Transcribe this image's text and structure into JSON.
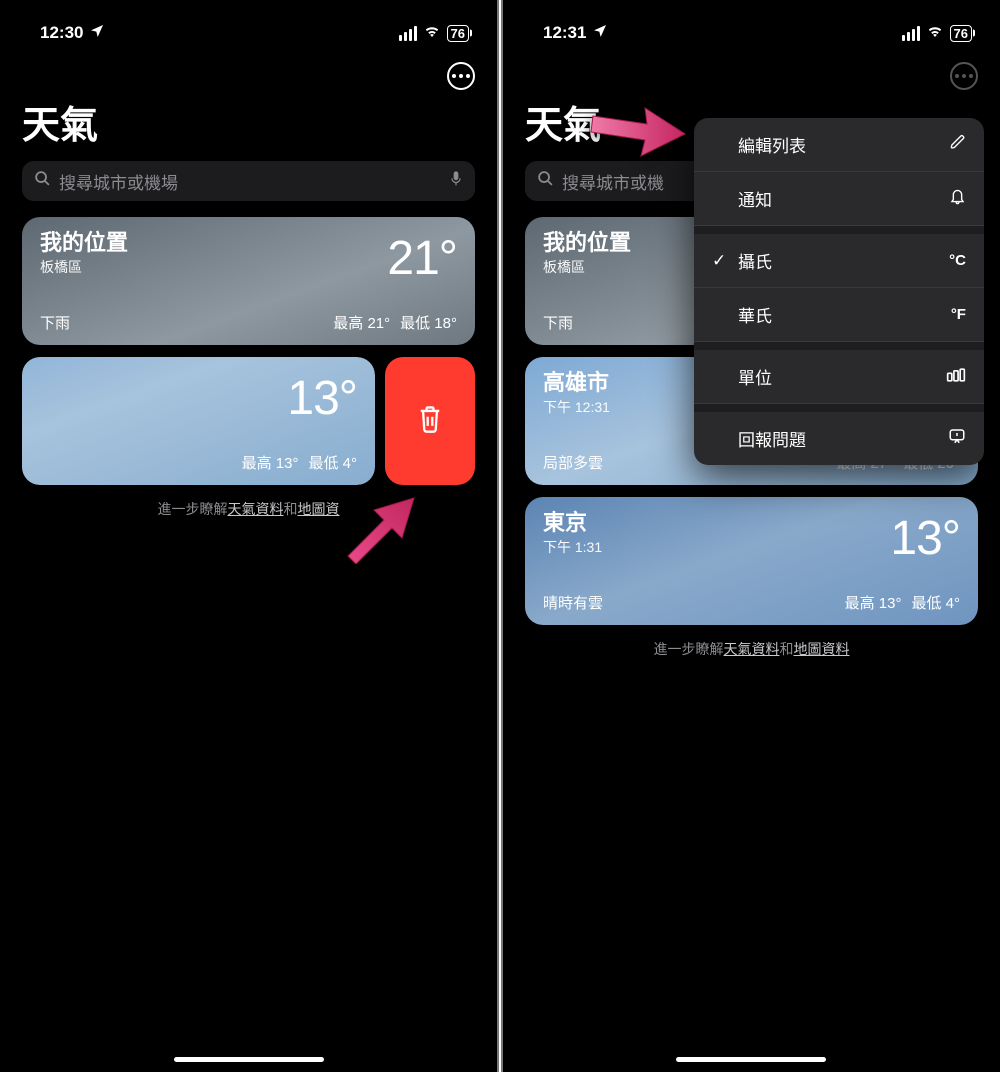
{
  "left": {
    "status": {
      "time": "12:30",
      "battery": "76"
    },
    "app_title": "天氣",
    "search_placeholder": "搜尋城市或機場",
    "cards": [
      {
        "title": "我的位置",
        "subtitle": "板橋區",
        "temp": "21°",
        "cond": "下雨",
        "hi": "最高 21°",
        "lo": "最低 18°"
      },
      {
        "title": "",
        "subtitle": "",
        "temp": "13°",
        "cond": "",
        "hi": "最高 13°",
        "lo": "最低 4°"
      }
    ],
    "footer_pre": "進一步瞭解",
    "footer_link1": "天氣資料",
    "footer_mid": "和",
    "footer_link2": "地圖資"
  },
  "right": {
    "status": {
      "time": "12:31",
      "battery": "76"
    },
    "app_title": "天氣",
    "search_placeholder": "搜尋城市或機",
    "menu": {
      "edit": "編輯列表",
      "notify": "通知",
      "celsius": "攝氏",
      "celsius_sym": "°C",
      "fahrenheit": "華氏",
      "fahrenheit_sym": "°F",
      "units": "單位",
      "report": "回報問題"
    },
    "cards": [
      {
        "title": "我的位置",
        "subtitle": "板橋區",
        "temp": "",
        "cond": "下雨",
        "hi": "",
        "lo": ""
      },
      {
        "title": "高雄市",
        "subtitle": "下午 12:31",
        "temp": "",
        "cond": "局部多雲",
        "hi": "最高 27°",
        "lo": "最低 20°"
      },
      {
        "title": "東京",
        "subtitle": "下午 1:31",
        "temp": "13°",
        "cond": "晴時有雲",
        "hi": "最高 13°",
        "lo": "最低 4°"
      }
    ],
    "footer_pre": "進一步瞭解",
    "footer_link1": "天氣資料",
    "footer_mid": "和",
    "footer_link2": "地圖資料"
  }
}
